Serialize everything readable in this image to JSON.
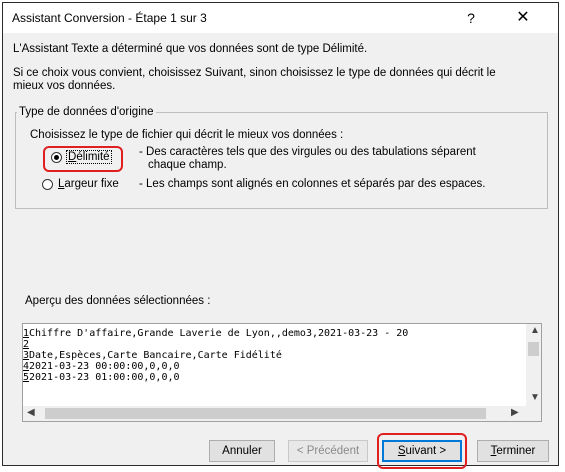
{
  "window": {
    "title": "Assistant Conversion - Étape 1 sur 3",
    "help_glyph": "?",
    "close_glyph": "✕"
  },
  "intro": {
    "line1": "L'Assistant Texte a déterminé que vos données sont de type Délimité.",
    "line2a": "Si ce choix vous convient, choisissez Suivant, sinon choisissez le type de données qui décrit le",
    "line2b": "mieux vos données."
  },
  "group": {
    "legend": "Type de données d'origine",
    "prompt": "Choisissez le type de fichier qui décrit le mieux vos données :",
    "options": [
      {
        "label": "Délimité",
        "selected": true,
        "desc1": "- Des caractères tels que des virgules ou des tabulations séparent",
        "desc2": "chaque champ."
      },
      {
        "label": "Largeur fixe",
        "selected": false,
        "desc1": "- Les champs sont alignés en colonnes et séparés par des espaces."
      }
    ]
  },
  "preview": {
    "label": "Aperçu des données sélectionnées :",
    "rows": [
      {
        "num": "1",
        "text": "Chiffre D'affaire,Grande Laverie de Lyon,,demo3,2021-03-23 - 20"
      },
      {
        "num": "2",
        "text": ""
      },
      {
        "num": "3",
        "text": "Date,Espèces,Carte Bancaire,Carte Fidélité"
      },
      {
        "num": "4",
        "text": "2021-03-23 00:00:00,0,0,0"
      },
      {
        "num": "5",
        "text": "2021-03-23 01:00:00,0,0,0"
      }
    ]
  },
  "buttons": {
    "cancel": "Annuler",
    "previous": "< Précédent",
    "next": "Suivant >",
    "finish": "Terminer"
  },
  "highlight_color": "#e02020"
}
